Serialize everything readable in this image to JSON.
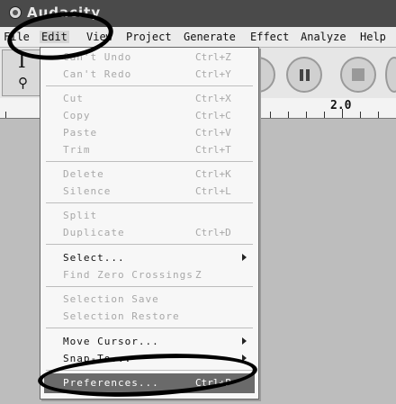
{
  "window": {
    "title": "Audacity"
  },
  "menubar": {
    "file": "File",
    "edit": "Edit",
    "view": "View",
    "project": "Project",
    "generate": "Generate",
    "effect": "Effect",
    "analyze": "Analyze",
    "help": "Help"
  },
  "ruler": {
    "label": "2.0"
  },
  "edit_menu": {
    "items": [
      {
        "label": "Can't Undo",
        "shortcut": "Ctrl+Z",
        "enabled": false
      },
      {
        "label": "Can't Redo",
        "shortcut": "Ctrl+Y",
        "enabled": false
      },
      {
        "label": "Cut",
        "shortcut": "Ctrl+X",
        "enabled": false
      },
      {
        "label": "Copy",
        "shortcut": "Ctrl+C",
        "enabled": false
      },
      {
        "label": "Paste",
        "shortcut": "Ctrl+V",
        "enabled": false
      },
      {
        "label": "Trim",
        "shortcut": "Ctrl+T",
        "enabled": false
      },
      {
        "label": "Delete",
        "shortcut": "Ctrl+K",
        "enabled": false
      },
      {
        "label": "Silence",
        "shortcut": "Ctrl+L",
        "enabled": false
      },
      {
        "label": "Split",
        "shortcut": "",
        "enabled": false
      },
      {
        "label": "Duplicate",
        "shortcut": "Ctrl+D",
        "enabled": false
      },
      {
        "label": "Select...",
        "shortcut": "",
        "enabled": true,
        "submenu": true
      },
      {
        "label": "Find Zero Crossings",
        "shortcut": "Z",
        "enabled": false
      },
      {
        "label": "Selection Save",
        "shortcut": "",
        "enabled": false
      },
      {
        "label": "Selection Restore",
        "shortcut": "",
        "enabled": false
      },
      {
        "label": "Move Cursor...",
        "shortcut": "",
        "enabled": true,
        "submenu": true
      },
      {
        "label": "Snap-To...",
        "shortcut": "",
        "enabled": true,
        "submenu": true
      },
      {
        "label": "Preferences...",
        "shortcut": "Ctrl+P",
        "enabled": true,
        "selected": true
      }
    ]
  }
}
